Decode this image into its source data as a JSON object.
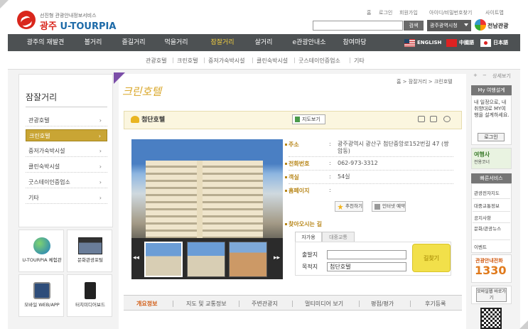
{
  "header": {
    "logo_sub": "선진형 관광안내정보서비스",
    "logo_city": "광주",
    "logo_brand": "U-TOURPIA",
    "util_links": [
      "홈",
      "로그인",
      "회원가입",
      "아이디/비밀번호찾기",
      "사이트맵"
    ],
    "search_button": "검색",
    "search_placeholder": "",
    "region_select": "광주광역시청",
    "region_name": "전남관광"
  },
  "gnb": {
    "items": [
      "광주의 재발견",
      "볼거리",
      "즐길거리",
      "먹을거리",
      "잠잘거리",
      "살거리",
      "e관광안내소",
      "참여마당"
    ],
    "active_index": 4,
    "languages": [
      "ENGLISH",
      "中國語",
      "日本語"
    ]
  },
  "submenu": [
    "관광호텔",
    "크린호텔",
    "중저가숙박시설",
    "클린숙박시설",
    "굿스테이인증업소",
    "기타"
  ],
  "lnb": {
    "title": "잠잘거리",
    "items": [
      "관광호텔",
      "크린호텔",
      "중저가숙박시설",
      "클린숙박시설",
      "굿스테이인증업소",
      "기타"
    ],
    "active_index": 1,
    "chevron": "›",
    "banners": [
      "U-TOURPIA 체험관",
      "문화관광포털",
      "모바일 WEB/APP",
      "터치미디어보드"
    ]
  },
  "content": {
    "page_title": "크린호텔",
    "breadcrumb": "홈 > 잠잘거리 > 크린호텔",
    "hotel_name": "첨단호텔",
    "map_button": "지도보기",
    "details": [
      {
        "label": "주소",
        "value": "광주광역시 광산구 첨단중앙로152번길 47 (쌍암동)"
      },
      {
        "label": "전화번호",
        "value": "062-973-3312"
      },
      {
        "label": "객실",
        "value": "54실"
      },
      {
        "label": "홈페이지",
        "value": ""
      }
    ],
    "recommend_button": "추천하기",
    "reserve_button": "인터넷 예약",
    "directions_label": "찾아오시는 길",
    "direction_tabs": [
      "자가용",
      "대중교통"
    ],
    "from_label": "출발지",
    "to_label": "목적지",
    "from_value": "",
    "to_value": "첨단호텔",
    "find_button": "길찾기",
    "thumb_prev": "◂◂",
    "thumb_next": "▸▸",
    "tabs": [
      "개요정보",
      "지도 및 교통정보",
      "주변관광지",
      "멀티미디어 보기",
      "평점/평가",
      "후기등록"
    ],
    "active_tab": 0
  },
  "right_sidebar": {
    "text_controls": [
      "+",
      "−",
      "상세보기"
    ],
    "my_title": "My 여행설계",
    "my_desc": "내 일정으로, 내 취향대로 MY여행을 설계하세요.",
    "login_button": "로그인",
    "agency_title": "여행사",
    "agency_sub": "전용코너",
    "quick_title": "빠른서비스",
    "quick_links": [
      "관광전자지도",
      "대중교통정보",
      "공지사항",
      "문화/관광뉴스",
      "이벤트"
    ],
    "phone_label": "관광안내전화",
    "phone_number": "1330",
    "mobile_button": "모바일웹 바로가기"
  },
  "colors": {
    "gnb_bg": "#4d5153",
    "accent_gold": "#c9a534",
    "brand_red": "#d9261c",
    "brand_blue": "#1d6aa8"
  }
}
